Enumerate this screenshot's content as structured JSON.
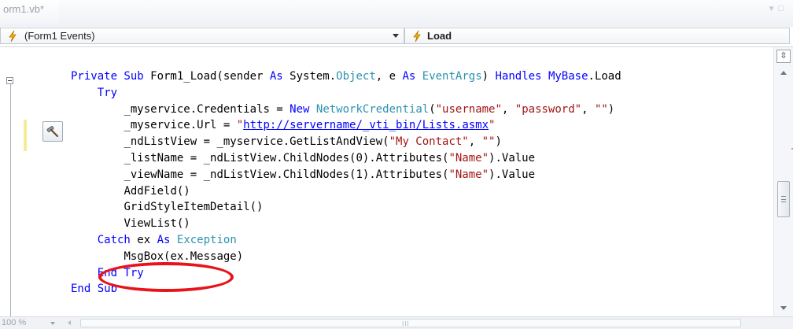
{
  "document_tab": {
    "title": "orm1.vb*"
  },
  "navbar": {
    "left_combo": {
      "label": "(Form1 Events)",
      "icon": "event-bolt-icon"
    },
    "right_combo": {
      "label": "Load",
      "icon": "event-bolt-icon"
    }
  },
  "colors": {
    "keyword": "#0000ff",
    "type": "#2b91af",
    "string": "#a31515",
    "highlight_ellipse": "#e8141b",
    "change_bar": "#f3ee94"
  },
  "code": {
    "l1": {
      "indent": "",
      "kw1": "Private Sub",
      "t1": " Form1_Load(sender ",
      "kw2": "As",
      "t2": " System.",
      "type1": "Object",
      "t3": ", e ",
      "kw3": "As",
      "t4": " ",
      "type2": "EventArgs",
      "t5": ") ",
      "kw4": "Handles",
      "t6": " ",
      "kw5": "MyBase",
      "t7": ".Load"
    },
    "l2": {
      "indent": "    ",
      "kw1": "Try"
    },
    "l3": {
      "indent": "        ",
      "t1": "_myservice.Credentials = ",
      "kw1": "New",
      "t2": " ",
      "type1": "NetworkCredential",
      "t3": "(",
      "s1": "\"username\"",
      "t4": ", ",
      "s2": "\"password\"",
      "t5": ", ",
      "s3": "\"\"",
      "t6": ")"
    },
    "l4": {
      "indent": "        ",
      "t1": "_myservice.Url = ",
      "s1": "\"",
      "url": "http://servername/_vti_bin/Lists.asmx",
      "s2": "\""
    },
    "l5": {
      "indent": "        ",
      "t1": "_ndListView = _myservice.GetListAndView(",
      "s1": "\"My Contact\"",
      "t2": ", ",
      "s2": "\"\"",
      "t3": ")"
    },
    "l6": {
      "indent": "        ",
      "t1": "_listName = _ndListView.ChildNodes(0).Attributes(",
      "s1": "\"Name\"",
      "t2": ").Value"
    },
    "l7": {
      "indent": "        ",
      "t1": "_viewName = _ndListView.ChildNodes(1).Attributes(",
      "s1": "\"Name\"",
      "t2": ").Value"
    },
    "l8": {
      "indent": "        ",
      "t1": "AddField()"
    },
    "l9": {
      "indent": "        ",
      "t1": "GridStyleItemDetail()"
    },
    "l10": {
      "indent": "        ",
      "t1": "ViewList()"
    },
    "l11": {
      "indent": "    ",
      "kw1": "Catch",
      "t1": " ex ",
      "kw2": "As",
      "t2": " ",
      "type1": "Exception"
    },
    "l12": {
      "indent": "        ",
      "t1": "MsgBox(ex.Message)"
    },
    "l13": {
      "indent": "    ",
      "kw1": "End Try"
    },
    "l14": {
      "indent": "",
      "kw1": "End Sub"
    }
  },
  "statusbar": {
    "zoom": "100 %",
    "hscroll_grip": "III"
  }
}
